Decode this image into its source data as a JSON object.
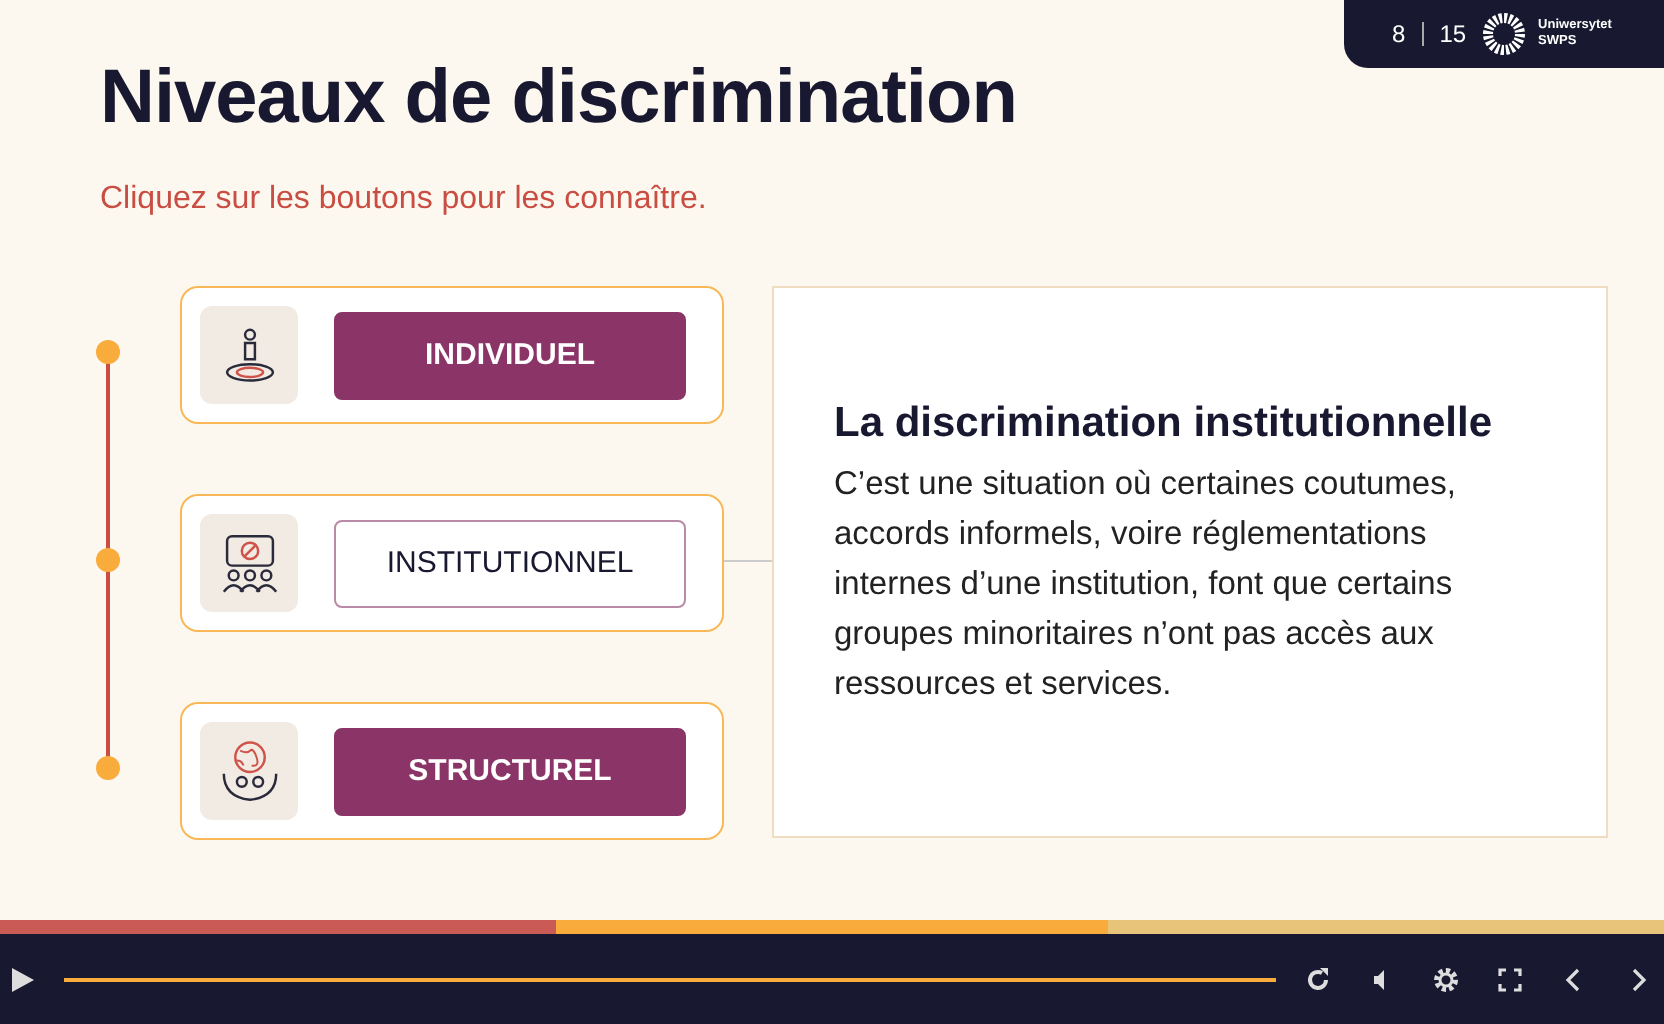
{
  "counter": {
    "current": "8",
    "total": "15"
  },
  "logo": {
    "text": "Uniwersytet\nSWPS"
  },
  "title": "Niveaux de discrimination",
  "subtitle": "Cliquez sur les boutons pour les connaître.",
  "levels": [
    {
      "kind": "person",
      "label": "INDIVIDUEL",
      "selected": false
    },
    {
      "kind": "group",
      "label": "INSTITUTIONNEL",
      "selected": true
    },
    {
      "kind": "globe",
      "label": "STRUCTUREL",
      "selected": false
    }
  ],
  "detail": {
    "heading": "La discrimination institutionnelle",
    "body": "C’est une situation où certaines coutumes, accords informels, voire réglementations internes d’une institution, font que certains groupes minoritaires n’ont pas accès aux ressources et services."
  },
  "player": {
    "level": 1
  }
}
